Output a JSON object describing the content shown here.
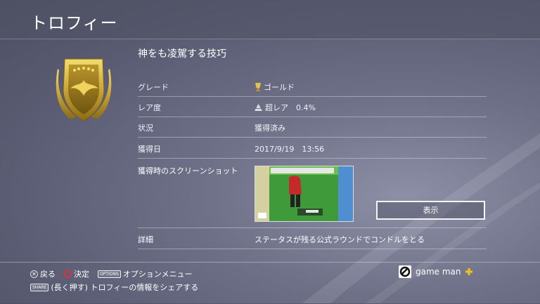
{
  "header": {
    "title": "トロフィー"
  },
  "trophy": {
    "name": "神をも凌駕する技巧",
    "rows": [
      {
        "label": "グレード",
        "value": "ゴールド",
        "icon": "gold-trophy-icon"
      },
      {
        "label": "レア度",
        "value": "超レア　0.4%",
        "icon": "rarity-icon"
      },
      {
        "label": "状況",
        "value": "獲得済み"
      },
      {
        "label": "獲得日",
        "value": "2017/9/19　13:56"
      }
    ],
    "screenshot_label": "獲得時のスクリーンショット",
    "show_button": "表示",
    "detail_label": "詳細",
    "detail_value": "ステータスが残る公式ラウンドでコンドルをとる"
  },
  "footer": {
    "back": "戻る",
    "confirm": "決定",
    "options_tag": "OPTIONS",
    "options": "オプションメニュー",
    "share_tag": "SHARE",
    "share": "(長く押す) トロフィーの情報をシェアする"
  },
  "user": {
    "name": "game man"
  },
  "colors": {
    "gold": "#c9a536",
    "confirm_red": "#e2303a",
    "plus_yellow": "#f0c419"
  }
}
